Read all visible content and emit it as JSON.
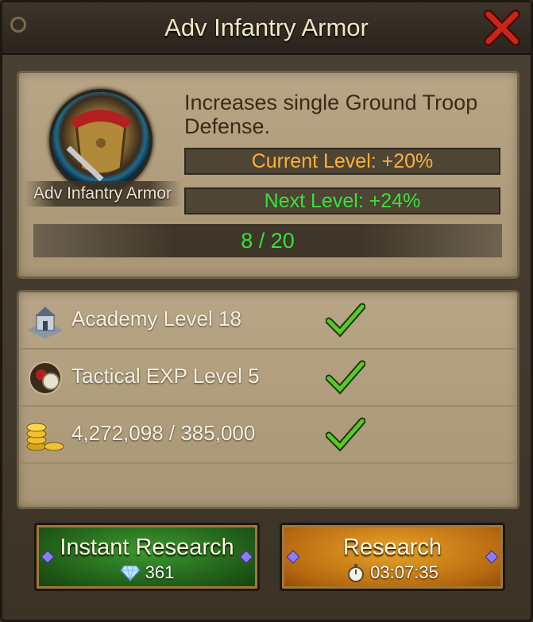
{
  "window": {
    "title": "Adv Infantry Armor",
    "close_icon": "close-x-icon"
  },
  "research": {
    "icon_caption": "Adv Infantry Armor",
    "description": "Increases single Ground Troop Defense.",
    "current_level": "Current Level: +20%",
    "next_level": "Next Level: +24%",
    "progress_text": "8 / 20",
    "progress": {
      "current": 8,
      "max": 20
    }
  },
  "requirements": [
    {
      "icon": "academy-icon",
      "label": "Academy Level 18",
      "met": true
    },
    {
      "icon": "tactical-exp-icon",
      "label": "Tactical EXP Level 5",
      "met": true
    },
    {
      "icon": "gold-icon",
      "label": "4,272,098 / 385,000",
      "met": true
    }
  ],
  "buttons": {
    "instant": {
      "label": "Instant Research",
      "cost": "361",
      "cost_icon": "diamond-icon"
    },
    "research": {
      "label": "Research",
      "time": "03:07:35",
      "time_icon": "stopwatch-icon"
    }
  },
  "colors": {
    "current_level": "#ffb13a",
    "next_level": "#36e23a",
    "instant_button": "#2f7f24",
    "research_button": "#d08818"
  }
}
